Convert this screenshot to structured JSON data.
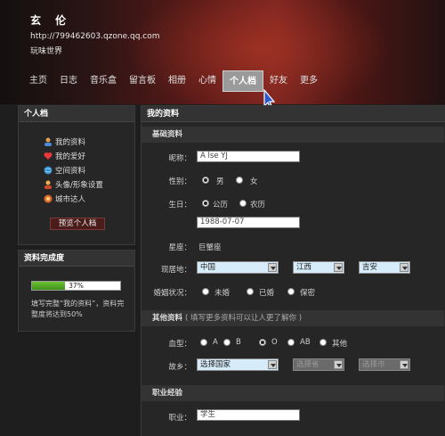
{
  "header": {
    "owner": "玄 伦",
    "url": "http://799462603.qzone.qq.com",
    "motto": "玩味世界"
  },
  "nav": {
    "tabs": [
      "主页",
      "日志",
      "音乐盒",
      "留言板",
      "相册",
      "心情",
      "个人档",
      "好友",
      "更多"
    ],
    "active": "个人档"
  },
  "sidebar": {
    "title": "个人档",
    "links": [
      {
        "label": "我的资料",
        "icon": "profile-icon"
      },
      {
        "label": "我的爱好",
        "icon": "heart-icon"
      },
      {
        "label": "空间资料",
        "icon": "globe-icon"
      },
      {
        "label": "头像/形象设置",
        "icon": "avatar-icon"
      },
      {
        "label": "城市达人",
        "icon": "city-icon"
      }
    ],
    "preview_button": "预览个人档"
  },
  "completion": {
    "title": "资料完成度",
    "percent": 37,
    "percent_text": "37%",
    "tip": "填写完整“我的资料”，资料完整度将达到50%"
  },
  "main": {
    "title": "我的资料",
    "basic_title": "基础资料",
    "nickname_label": "昵称：",
    "nickname_value": "A lse YJ",
    "gender_label": "性别：",
    "gender_male": "男",
    "gender_female": "女",
    "gender_selected": "男",
    "birthday_label": "生日：",
    "calendar_solar": "公历",
    "calendar_lunar": "农历",
    "calendar_selected": "公历",
    "birthday_value": "1988-07-07",
    "zodiac_label": "星座：",
    "zodiac_value": "巨蟹座",
    "residence_label": "现居地：",
    "residence_country": "中国",
    "residence_province": "江西",
    "residence_city": "吉安",
    "marital_label": "婚姻状况：",
    "marital_options": [
      "未婚",
      "已婚",
      "保密"
    ],
    "other_title": "其他资料",
    "other_note": "( 填写更多资料可以让人更了解你 )",
    "blood_label": "血型：",
    "blood_options": [
      "A",
      "B",
      "O",
      "AB",
      "其他"
    ],
    "blood_selected": "O",
    "hometown_label": "故乡：",
    "hometown_country": "选择国家",
    "hometown_province": "选择省",
    "hometown_city": "选择市",
    "career_title": "职业经验",
    "job_label": "职业：",
    "job_value": "学生"
  },
  "colors": {
    "header_accent": "#7a2420",
    "progress_green": "#5cb82a",
    "select_blue": "#d6ecfa"
  }
}
